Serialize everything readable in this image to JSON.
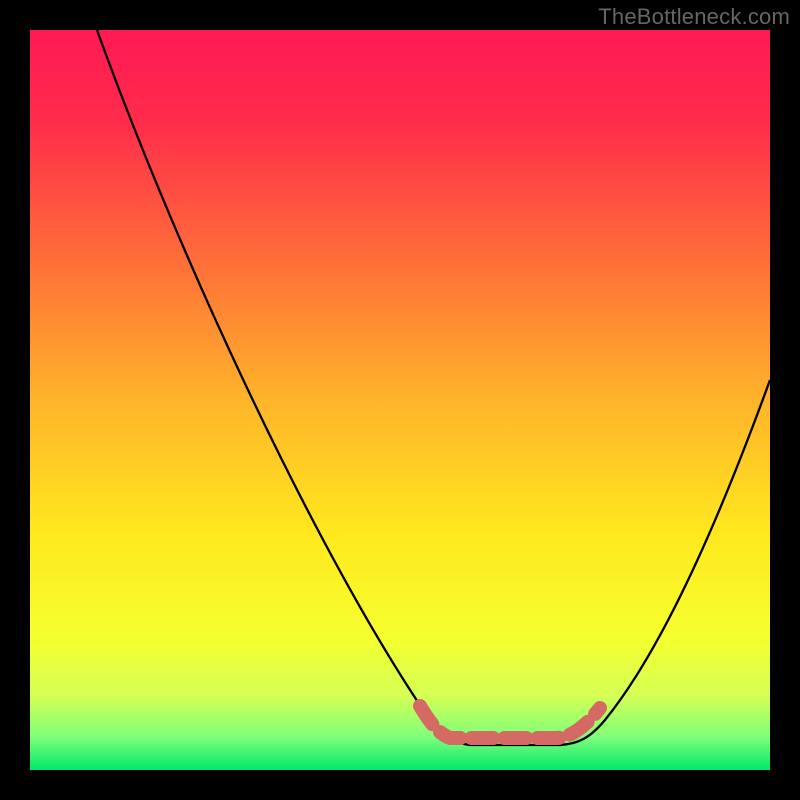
{
  "watermark": "TheBottleneck.com",
  "chart_data": {
    "type": "line",
    "title": "",
    "xlabel": "",
    "ylabel": "",
    "x": [
      0.0,
      0.05,
      0.1,
      0.15,
      0.2,
      0.25,
      0.3,
      0.35,
      0.4,
      0.45,
      0.5,
      0.55,
      0.6,
      0.62,
      0.65,
      0.68,
      0.7,
      0.73,
      0.77,
      0.82,
      0.88,
      0.94,
      1.0
    ],
    "series": [
      {
        "name": "bottleneck_curve",
        "values": [
          1.0,
          0.93,
          0.84,
          0.75,
          0.66,
          0.56,
          0.46,
          0.36,
          0.26,
          0.17,
          0.09,
          0.04,
          0.02,
          0.01,
          0.01,
          0.01,
          0.02,
          0.03,
          0.07,
          0.15,
          0.27,
          0.4,
          0.53
        ]
      }
    ],
    "optimal_band_x": [
      0.55,
      0.74
    ],
    "xlim": [
      0,
      1
    ],
    "ylim": [
      0,
      1
    ],
    "background_gradient": [
      "#ff1a55",
      "#ff6a3a",
      "#ffe81e",
      "#7fff7a",
      "#00e86b"
    ],
    "accent_band_color": "#d46a63",
    "grid": false,
    "legend": false
  }
}
